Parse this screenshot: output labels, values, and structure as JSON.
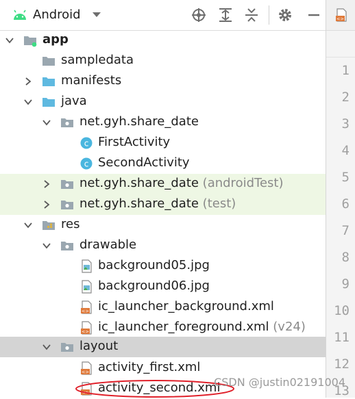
{
  "toolbar": {
    "view_label": "Android",
    "icons": [
      "android-icon",
      "dropdown-caret-icon",
      "locate-target-icon",
      "expand-all-icon",
      "collapse-all-icon",
      "gear-icon",
      "minimize-icon"
    ]
  },
  "tree": {
    "rows": [
      {
        "label": "app",
        "suffix": "",
        "icon": "module-folder-icon",
        "state": "expanded"
      },
      {
        "label": "sampledata",
        "suffix": "",
        "icon": "folder-icon",
        "state": "leaf"
      },
      {
        "label": "manifests",
        "suffix": "",
        "icon": "folder-icon",
        "state": "collapsed"
      },
      {
        "label": "java",
        "suffix": "",
        "icon": "source-folder-icon",
        "state": "expanded"
      },
      {
        "label": "net.gyh.share_date",
        "suffix": "",
        "icon": "package-icon",
        "state": "expanded"
      },
      {
        "label": "FirstActivity",
        "suffix": "",
        "icon": "class-icon",
        "state": "leaf"
      },
      {
        "label": "SecondActivity",
        "suffix": "",
        "icon": "class-icon",
        "state": "leaf"
      },
      {
        "label": "net.gyh.share_date",
        "suffix": " (androidTest)",
        "icon": "package-icon",
        "state": "collapsed"
      },
      {
        "label": "net.gyh.share_date",
        "suffix": " (test)",
        "icon": "package-icon",
        "state": "collapsed"
      },
      {
        "label": "res",
        "suffix": "",
        "icon": "res-folder-icon",
        "state": "expanded"
      },
      {
        "label": "drawable",
        "suffix": "",
        "icon": "package-icon",
        "state": "expanded"
      },
      {
        "label": "background05.jpg",
        "suffix": "",
        "icon": "image-file-icon",
        "state": "leaf"
      },
      {
        "label": "background06.jpg",
        "suffix": "",
        "icon": "image-file-icon",
        "state": "leaf"
      },
      {
        "label": "ic_launcher_background.xml",
        "suffix": "",
        "icon": "xml-file-icon",
        "state": "leaf"
      },
      {
        "label": "ic_launcher_foreground.xml",
        "suffix": " (v24)",
        "icon": "xml-file-icon",
        "state": "leaf"
      },
      {
        "label": "layout",
        "suffix": "",
        "icon": "package-icon",
        "state": "expanded"
      },
      {
        "label": "activity_first.xml",
        "suffix": "",
        "icon": "xml-file-icon",
        "state": "leaf"
      },
      {
        "label": "activity_second.xml",
        "suffix": "",
        "icon": "xml-file-icon",
        "state": "leaf"
      }
    ]
  },
  "gutter": {
    "line_numbers": [
      "1",
      "2",
      "3",
      "4",
      "5",
      "6",
      "7",
      "8",
      "9",
      "10",
      "11",
      "12",
      "13"
    ]
  },
  "watermark": "CSDN @justin02191004",
  "colors": {
    "green_row": "#eef7e4",
    "selected_row": "#d4d4d4",
    "folder": "#9aa7b0",
    "source_folder": "#5fb9e0",
    "class_badge": "#4ab6df",
    "xml_badge": "#e07b3c",
    "annotation_red": "#e0202a"
  }
}
